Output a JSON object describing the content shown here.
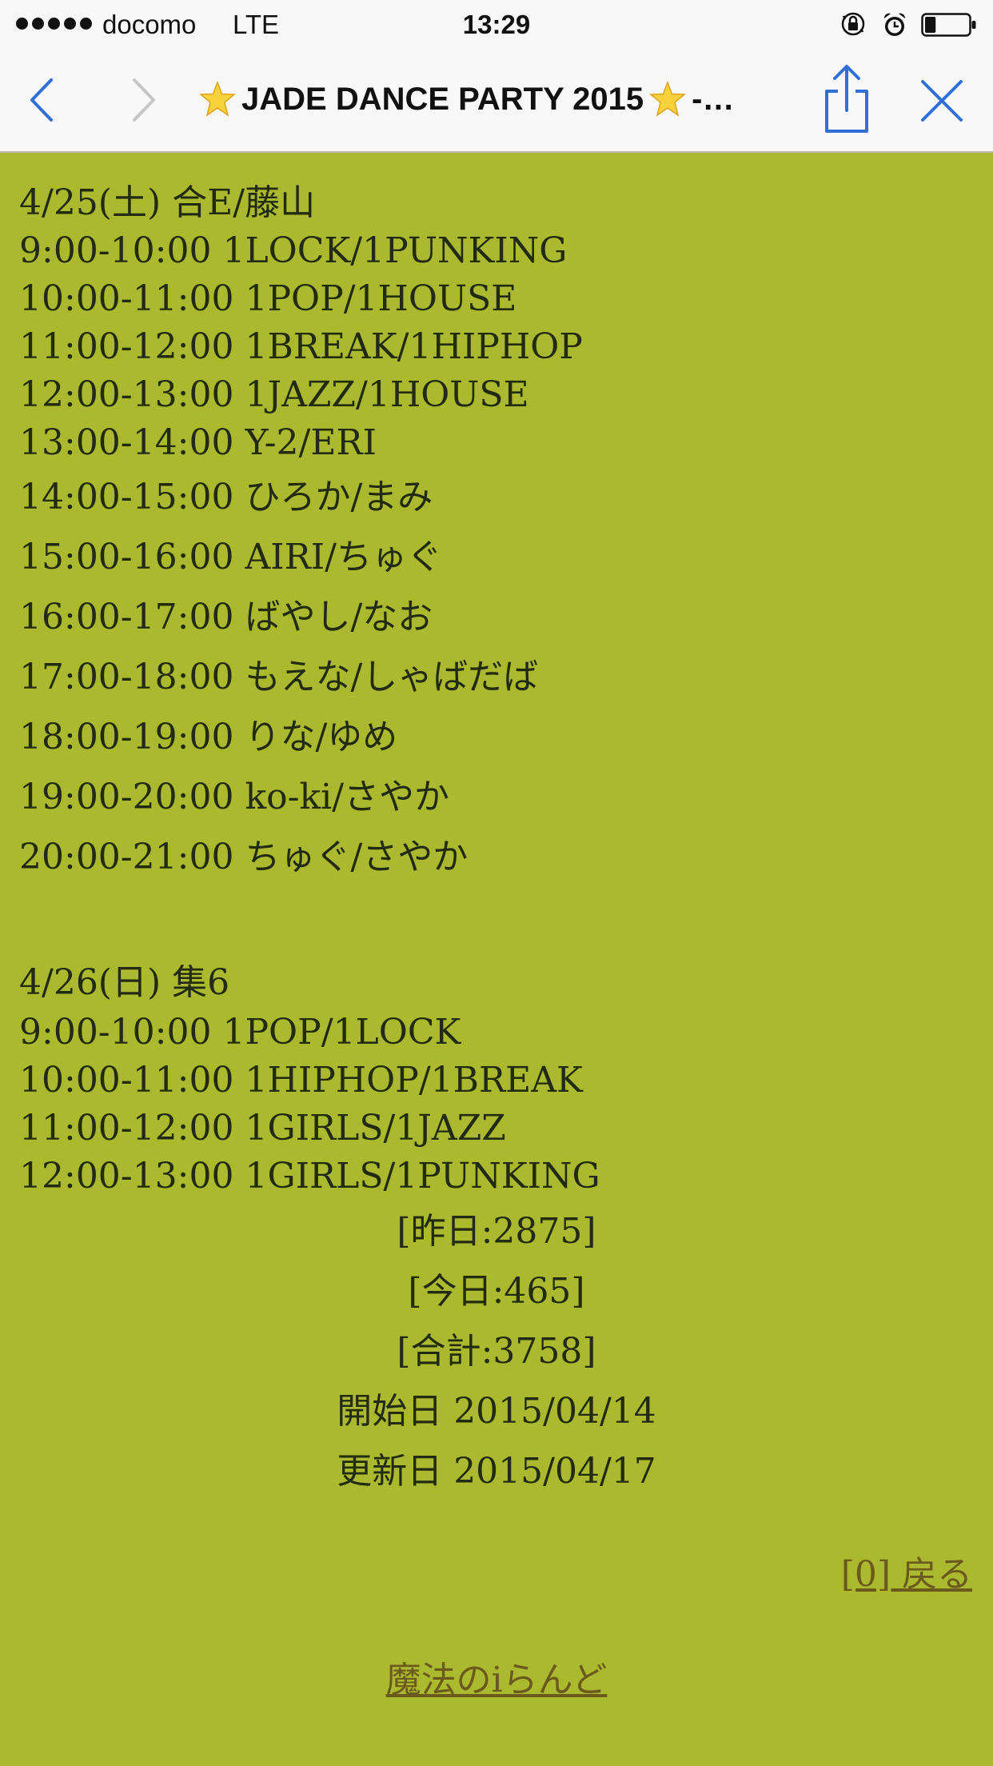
{
  "status_bar": {
    "carrier": "docomo",
    "network": "LTE",
    "time": "13:29",
    "battery_level": 0.25
  },
  "nav_bar": {
    "title": "JADE DANCE PARTY 2015",
    "title_suffix": "-…",
    "icons": [
      "back-chevron-icon",
      "forward-chevron-icon",
      "share-icon",
      "close-icon",
      "star-icon"
    ]
  },
  "schedule": {
    "day1": {
      "header": "4/25(土) 合E/藤山",
      "slots": [
        "9:00-10:00 1LOCK/1PUNKING",
        "10:00-11:00 1POP/1HOUSE",
        "11:00-12:00 1BREAK/1HIPHOP",
        "12:00-13:00 1JAZZ/1HOUSE",
        "13:00-14:00 Y-2/ERI",
        "14:00-15:00 ひろか/まみ",
        "15:00-16:00 AIRI/ちゅぐ",
        "16:00-17:00 ばやし/なお",
        "17:00-18:00 もえな/しゃばだば",
        "18:00-19:00 りな/ゆめ",
        "19:00-20:00 ko-ki/さやか",
        "20:00-21:00 ちゅぐ/さやか"
      ]
    },
    "day2": {
      "header": "4/26(日) 集6",
      "slots": [
        "9:00-10:00 1POP/1LOCK",
        "10:00-11:00 1HIPHOP/1BREAK",
        "11:00-12:00 1GIRLS/1JAZZ",
        "12:00-13:00 1GIRLS/1PUNKING"
      ]
    }
  },
  "counters": {
    "yesterday": "[昨日:2875]",
    "today": "[今日:465]",
    "total": "[合計:3758]",
    "start_date": "開始日 2015/04/14",
    "updated_date": "更新日 2015/04/17"
  },
  "links": {
    "back": "[0] 戻る",
    "footer": "魔法のiらんど"
  },
  "colors": {
    "page_background": "#aab92e",
    "text": "#222a12",
    "link": "#6b5a1e",
    "bar_background": "#f8f8f8",
    "icon_tint": "#2f6fd6"
  }
}
